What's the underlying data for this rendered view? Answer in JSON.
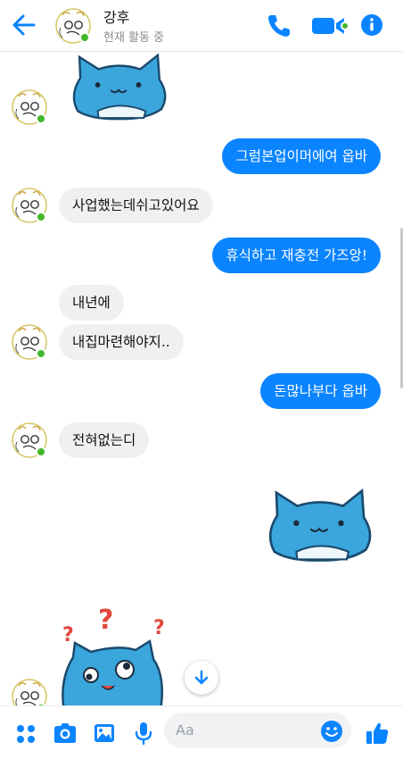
{
  "header": {
    "name": "강후",
    "status": "현재 활동 중"
  },
  "messages": [
    {
      "side": "out",
      "text": "그럼본업이머에여 옵바"
    },
    {
      "side": "in",
      "text": "사업했는데쉬고있어요"
    },
    {
      "side": "out",
      "text": "휴식하고 재충전 가즈앙!"
    },
    {
      "side": "in",
      "text": "내년에"
    },
    {
      "side": "in",
      "text": "내집마련해야지.."
    },
    {
      "side": "out",
      "text": "돈많나부다 옵바"
    },
    {
      "side": "in",
      "text": "전혀없는디"
    }
  ],
  "composer": {
    "placeholder": "Aa"
  },
  "colors": {
    "accent": "#0a84ff",
    "incoming_bubble": "#f0f0f0",
    "online": "#42b72a"
  },
  "icons": [
    "back-arrow-icon",
    "phone-icon",
    "video-camera-icon",
    "info-icon",
    "grid-icon",
    "camera-icon",
    "image-icon",
    "microphone-icon",
    "emoji-icon",
    "thumbs-up-icon",
    "scroll-down-icon"
  ]
}
